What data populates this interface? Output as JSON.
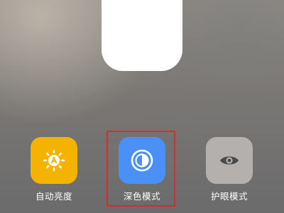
{
  "controls": [
    {
      "label": "自动亮度",
      "icon": "sun-a-icon",
      "color": "#f5b301"
    },
    {
      "label": "深色模式",
      "icon": "contrast-circle-icon",
      "color": "#4a90f7"
    },
    {
      "label": "护眼模式",
      "icon": "eye-icon",
      "color": "#b3b0ad"
    }
  ],
  "highlight_color": "#e02a2a"
}
